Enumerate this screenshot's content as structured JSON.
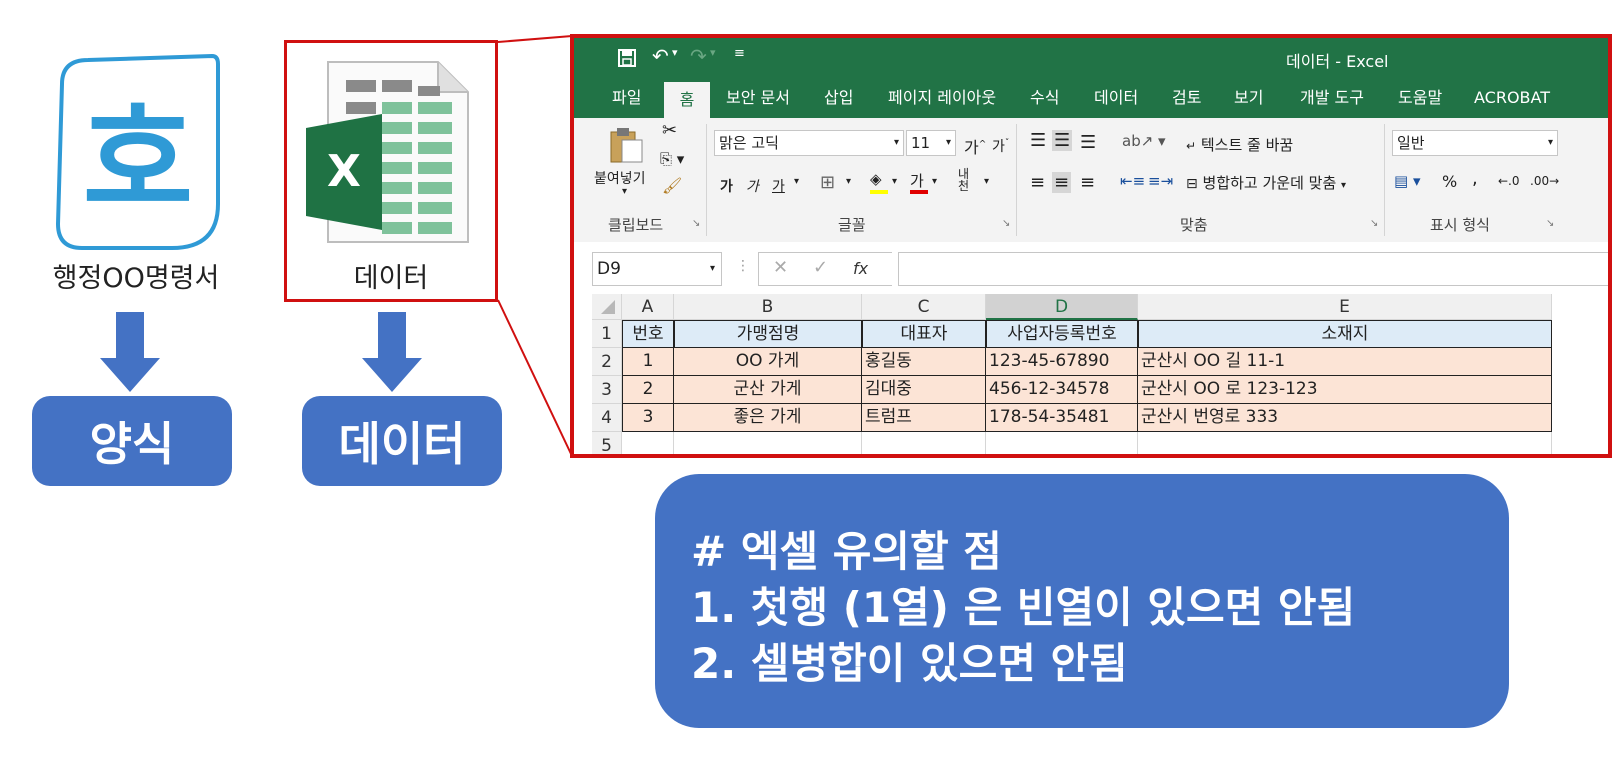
{
  "left": {
    "hwp_glyph": "호",
    "hwp_label": "행정OO명령서",
    "excel_label": "데이터",
    "tag1": "양식",
    "tag2": "데이터",
    "accent": "#4472c4",
    "highlight": "#d01010"
  },
  "excel": {
    "title": "데이터  -  Excel",
    "tabs": [
      "파일",
      "홈",
      "보안 문서",
      "삽입",
      "페이지 레이아웃",
      "수식",
      "데이터",
      "검토",
      "보기",
      "개발 도구",
      "도움말",
      "ACROBAT"
    ],
    "active_tab": "홈",
    "ribbon": {
      "paste_label": "붙여넣기",
      "clipboard_group": "클립보드",
      "font_name": "맑은 고딕",
      "font_size": "11",
      "font_group": "글꼴",
      "wrap_text": "텍스트 줄 바꿈",
      "merge_center": "병합하고 가운데 맞춤",
      "align_group": "맞춤",
      "number_format": "일반",
      "number_group": "표시 형식",
      "bold": "가",
      "italic": "가",
      "underline": "가",
      "font_color": "가",
      "grow_font": "가",
      "shrink_font": "가",
      "percent": "%",
      "comma": ","
    },
    "name_box": "D9",
    "fx": "fx",
    "columns": [
      "A",
      "B",
      "C",
      "D",
      "E"
    ],
    "row_numbers": [
      "1",
      "2",
      "3",
      "4",
      "5"
    ],
    "header_row": [
      "번호",
      "가맹점명",
      "대표자",
      "사업자등록번호",
      "소재지"
    ],
    "rows": [
      [
        "1",
        "OO 가게",
        "홍길동",
        "123-45-67890",
        "군산시 OO 길 11-1"
      ],
      [
        "2",
        "군산 가게",
        "김대중",
        "456-12-34578",
        "군산시 OO 로 123-123"
      ],
      [
        "3",
        "좋은 가게",
        "트럼프",
        "178-54-35481",
        "군산시 번영로 333"
      ]
    ],
    "brand_color": "#217346"
  },
  "note": {
    "line1": "# 엑셀 유의할 점",
    "line2": "1.    첫행 (1열) 은 빈열이 있으면 안됨",
    "line3": "2. 셀병합이 있으면 안됨"
  }
}
